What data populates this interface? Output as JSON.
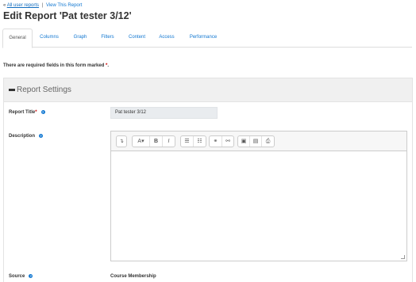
{
  "breadcrumb": {
    "prefix": "«",
    "all_reports": "All user reports",
    "separator": "|",
    "view_report": "View This Report"
  },
  "page": {
    "title": "Edit Report 'Pat tester 3/12'"
  },
  "tabs": [
    {
      "label": "General",
      "active": true
    },
    {
      "label": "Columns",
      "active": false
    },
    {
      "label": "Graph",
      "active": false
    },
    {
      "label": "Filters",
      "active": false
    },
    {
      "label": "Content",
      "active": false
    },
    {
      "label": "Access",
      "active": false
    },
    {
      "label": "Performance",
      "active": false
    }
  ],
  "form": {
    "required_note": "There are required fields in this form marked",
    "required_marker": "*",
    "required_note_end": ".",
    "section_title": "Report Settings",
    "fields": {
      "report_title": {
        "label": "Report Title",
        "value": "Pat tester 3/12",
        "required": true
      },
      "description": {
        "label": "Description",
        "value": ""
      },
      "source": {
        "label": "Source",
        "value": "Course Membership"
      }
    }
  },
  "editor": {
    "toolbar": {
      "expand": "↴",
      "font": "A",
      "bold": "B",
      "italic": "I",
      "ul": "☰",
      "ol": "☷",
      "link": "⚭",
      "unlink": "⚯",
      "image": "▣",
      "media": "▤",
      "manage": "⎙"
    }
  },
  "colors": {
    "link": "#1177d1",
    "required": "#cc0000",
    "section_header_bg": "#f0f0f0",
    "input_bg": "#e9ecef"
  }
}
